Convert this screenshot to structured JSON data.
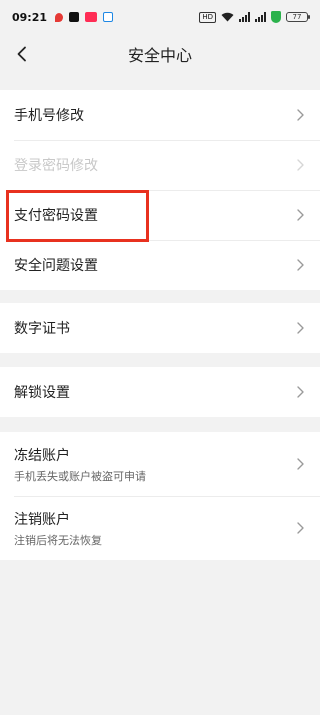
{
  "status_bar": {
    "time": "09:21",
    "network_badge": "HD",
    "battery": "77"
  },
  "header": {
    "title": "安全中心"
  },
  "groups": [
    {
      "items": [
        {
          "label": "手机号修改"
        },
        {
          "label": "登录密码修改",
          "disabled": true
        },
        {
          "label": "支付密码设置",
          "highlighted": true
        },
        {
          "label": "安全问题设置"
        }
      ]
    },
    {
      "items": [
        {
          "label": "数字证书"
        }
      ]
    },
    {
      "items": [
        {
          "label": "解锁设置"
        }
      ]
    },
    {
      "items": [
        {
          "label": "冻结账户",
          "subtitle": "手机丢失或账户被盗可申请"
        },
        {
          "label": "注销账户",
          "subtitle": "注销后将无法恢复"
        }
      ]
    }
  ],
  "colors": {
    "highlight": "#e8311f",
    "background": "#f2f2f2",
    "disabled_text": "#c8c8c8"
  },
  "icons": [
    "back-arrow-icon",
    "chevron-right-icon",
    "wifi-icon",
    "signal-icon",
    "battery-icon",
    "shield-icon"
  ]
}
